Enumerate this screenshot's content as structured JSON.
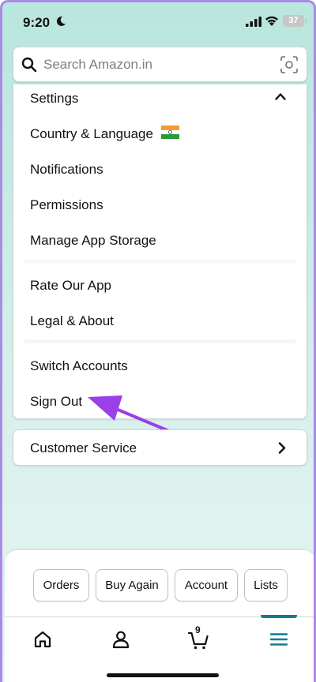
{
  "status_bar": {
    "time": "9:20",
    "battery": "37"
  },
  "search": {
    "placeholder": "Search Amazon.in"
  },
  "menu": {
    "header": "Settings",
    "items": [
      {
        "label": "Country & Language"
      },
      {
        "label": "Notifications"
      },
      {
        "label": "Permissions"
      },
      {
        "label": "Manage App Storage"
      },
      {
        "label": "Rate Our App"
      },
      {
        "label": "Legal & About"
      },
      {
        "label": "Switch Accounts"
      },
      {
        "label": "Sign Out"
      }
    ]
  },
  "customer_service": {
    "label": "Customer Service"
  },
  "quick_links": [
    {
      "label": "Orders"
    },
    {
      "label": "Buy Again"
    },
    {
      "label": "Account"
    },
    {
      "label": "Lists"
    }
  ],
  "tabbar": {
    "items": [
      {
        "icon": "home-icon"
      },
      {
        "icon": "profile-icon"
      },
      {
        "icon": "cart-icon",
        "badge": "9"
      },
      {
        "icon": "menu-icon",
        "selected": true
      }
    ],
    "accent": "#0f7c90"
  },
  "annotation": {
    "color": "#9b3fe6"
  }
}
